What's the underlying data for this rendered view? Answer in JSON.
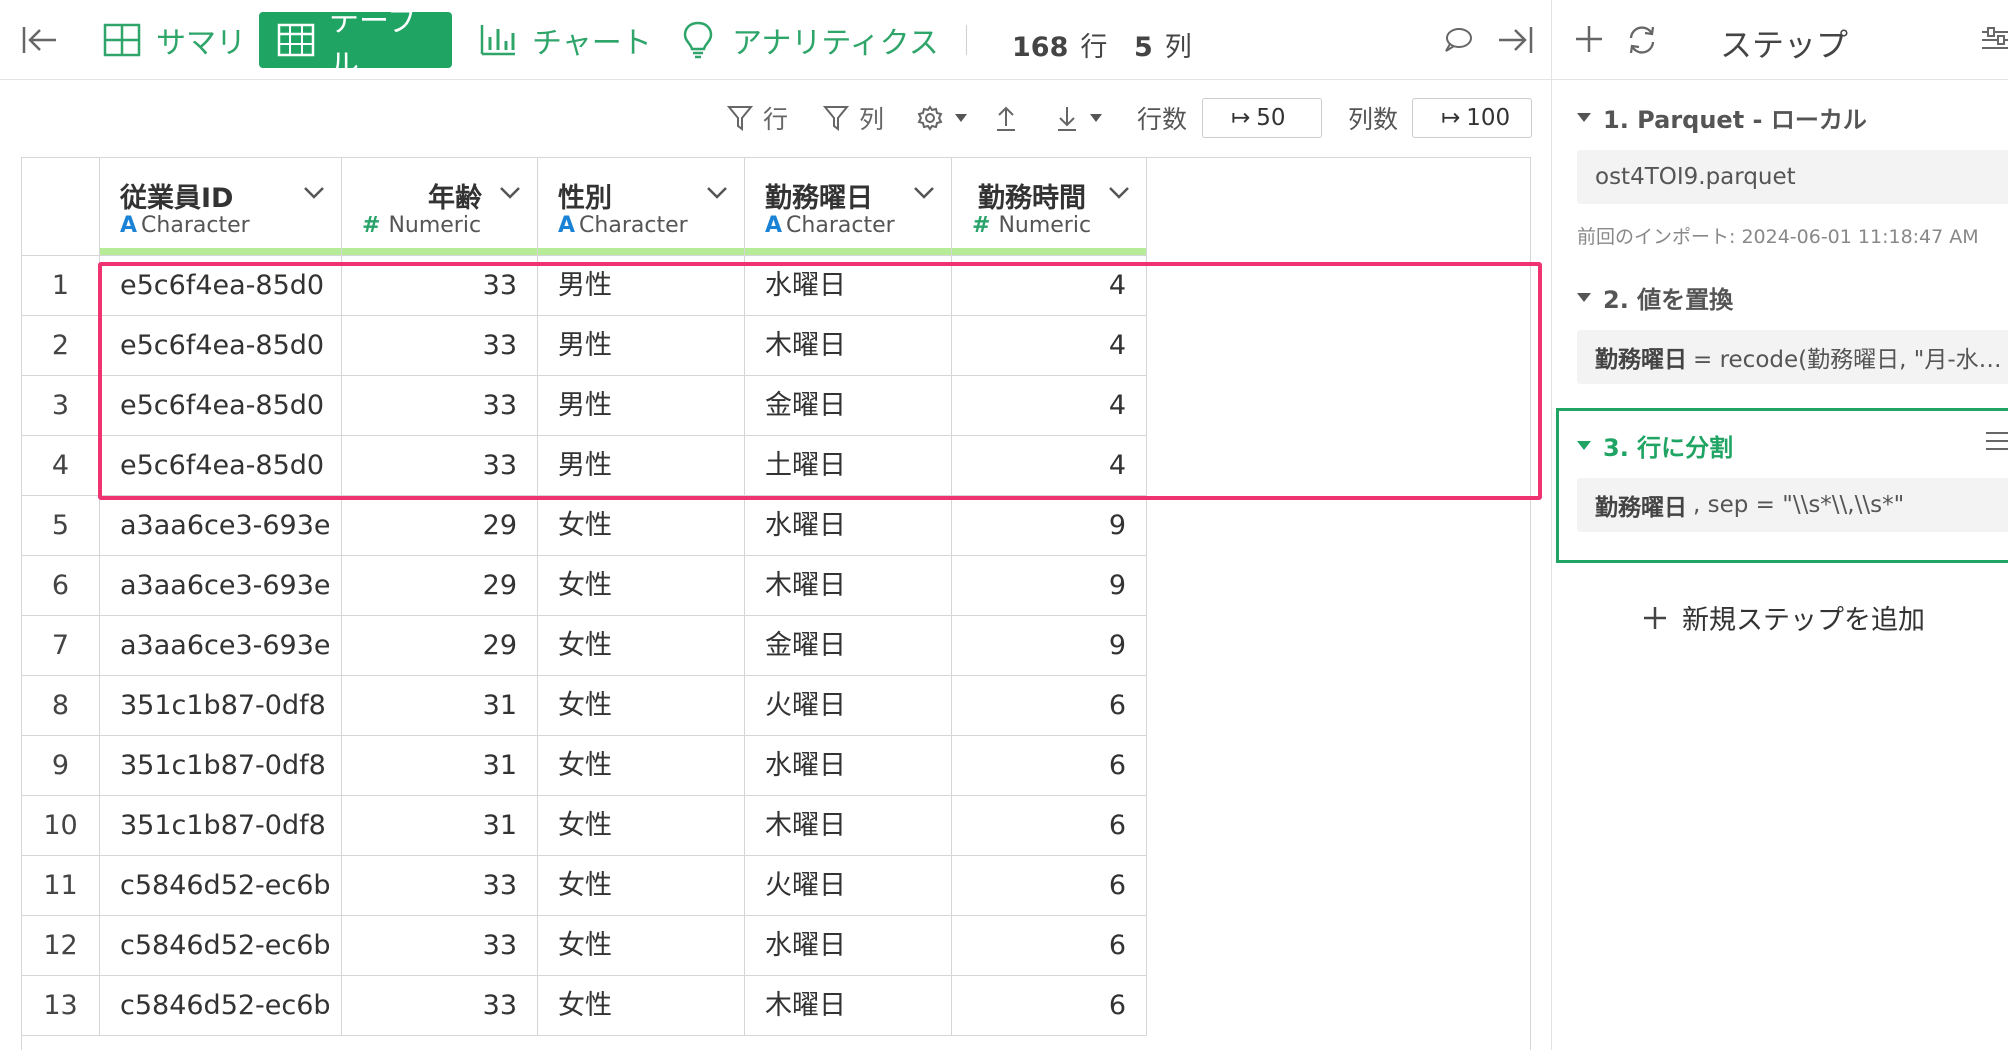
{
  "toolbar": {
    "tabs": [
      {
        "label": "サマリ",
        "icon": "summary-grid-icon"
      },
      {
        "label": "テーブル",
        "icon": "table-icon",
        "active": true
      },
      {
        "label": "チャート",
        "icon": "bar-chart-icon"
      },
      {
        "label": "アナリティクス",
        "icon": "lightbulb-icon"
      }
    ],
    "rows_count": "168",
    "rows_unit": "行",
    "cols_count": "5",
    "cols_unit": "列"
  },
  "table_toolbar": {
    "filter_row": "行",
    "filter_col": "列",
    "rows_label": "行数",
    "rows_value": "50",
    "cols_label": "列数",
    "cols_value": "100"
  },
  "columns": [
    {
      "name": "従業員ID",
      "type": "Character"
    },
    {
      "name": "年齢",
      "type": "Numeric"
    },
    {
      "name": "性別",
      "type": "Character"
    },
    {
      "name": "勤務曜日",
      "type": "Character"
    },
    {
      "name": "勤務時間",
      "type": "Numeric"
    }
  ],
  "rows": [
    [
      "1",
      "e5c6f4ea-85d0",
      "33",
      "男性",
      "水曜日",
      "4"
    ],
    [
      "2",
      "e5c6f4ea-85d0",
      "33",
      "男性",
      "木曜日",
      "4"
    ],
    [
      "3",
      "e5c6f4ea-85d0",
      "33",
      "男性",
      "金曜日",
      "4"
    ],
    [
      "4",
      "e5c6f4ea-85d0",
      "33",
      "男性",
      "土曜日",
      "4"
    ],
    [
      "5",
      "a3aa6ce3-693e",
      "29",
      "女性",
      "水曜日",
      "9"
    ],
    [
      "6",
      "a3aa6ce3-693e",
      "29",
      "女性",
      "木曜日",
      "9"
    ],
    [
      "7",
      "a3aa6ce3-693e",
      "29",
      "女性",
      "金曜日",
      "9"
    ],
    [
      "8",
      "351c1b87-0df8",
      "31",
      "女性",
      "火曜日",
      "6"
    ],
    [
      "9",
      "351c1b87-0df8",
      "31",
      "女性",
      "水曜日",
      "6"
    ],
    [
      "10",
      "351c1b87-0df8",
      "31",
      "女性",
      "木曜日",
      "6"
    ],
    [
      "11",
      "c5846d52-ec6b",
      "33",
      "女性",
      "火曜日",
      "6"
    ],
    [
      "12",
      "c5846d52-ec6b",
      "33",
      "女性",
      "水曜日",
      "6"
    ],
    [
      "13",
      "c5846d52-ec6b",
      "33",
      "女性",
      "木曜日",
      "6"
    ]
  ],
  "steps_panel": {
    "title": "ステップ",
    "steps": [
      {
        "title": "1. Parquet - ローカル",
        "content": "ost4TOI9.parquet",
        "meta": "前回のインポート: 2024-06-01 11:18:47 AM"
      },
      {
        "title": "2. 値を置換",
        "content_bold": "勤務曜日",
        "content": "= recode(勤務曜日, \"月-水…"
      },
      {
        "title": "3. 行に分割",
        "content_bold": "勤務曜日",
        "content": ", sep = \"\\\\s*\\\\,\\\\s*\"",
        "active": true
      }
    ],
    "add_step": "新規ステップを追加"
  },
  "colors": {
    "accent": "#1fa463",
    "highlight": "#ef3270",
    "type_char": "#1a83d6",
    "type_num": "#2aa36a"
  }
}
